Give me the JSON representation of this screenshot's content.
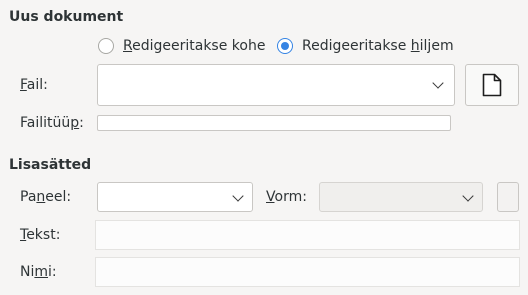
{
  "new_document": {
    "title": "Uus dokument",
    "radio_now": {
      "pre": "",
      "mnemonic": "R",
      "post": "edigeeritakse kohe",
      "checked": false
    },
    "radio_later": {
      "pre": "Redigeeritakse ",
      "mnemonic": "h",
      "post": "iljem",
      "checked": true
    },
    "file": {
      "pre": "",
      "mnemonic": "F",
      "post": "ail:",
      "value": ""
    },
    "file_type": {
      "pre": "Failitüü",
      "mnemonic": "p",
      "post": ":",
      "value": ""
    },
    "browse_icon": "document-icon"
  },
  "extra_settings": {
    "title": "Lisasätted",
    "panel": {
      "pre": "Pa",
      "mnemonic": "n",
      "post": "eel:",
      "value": ""
    },
    "form": {
      "pre": "",
      "mnemonic": "V",
      "post": "orm:",
      "value": ""
    },
    "text": {
      "pre": "",
      "mnemonic": "T",
      "post": "ekst:",
      "value": ""
    },
    "name": {
      "pre": "Ni",
      "mnemonic": "m",
      "post": "i:",
      "value": ""
    }
  },
  "colors": {
    "accent": "#3584e4",
    "background": "#f6f5f4"
  }
}
